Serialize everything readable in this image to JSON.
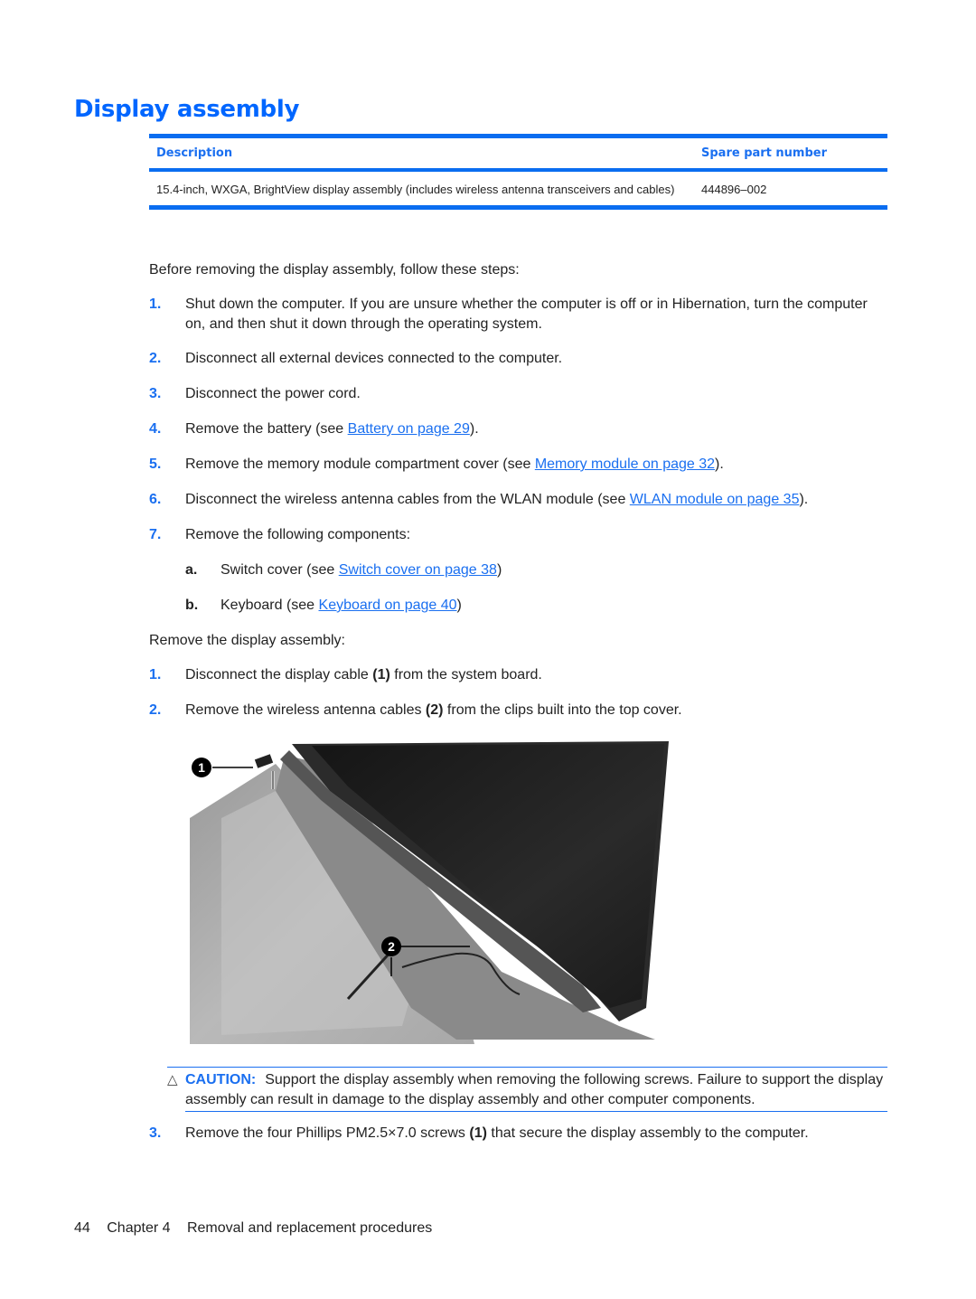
{
  "title": "Display assembly",
  "table": {
    "headers": {
      "description": "Description",
      "part_number": "Spare part number"
    },
    "rows": [
      {
        "description": "15.4-inch, WXGA, BrightView display assembly (includes wireless antenna transceivers and cables)",
        "part_number": "444896–002"
      }
    ]
  },
  "intro": "Before removing the display assembly, follow these steps:",
  "prep_steps": [
    {
      "num": "1.",
      "text": "Shut down the computer. If you are unsure whether the computer is off or in Hibernation, turn the computer on, and then shut it down through the operating system."
    },
    {
      "num": "2.",
      "text": "Disconnect all external devices connected to the computer."
    },
    {
      "num": "3.",
      "text": "Disconnect the power cord."
    },
    {
      "num": "4.",
      "text_before": "Remove the battery (see ",
      "link": "Battery on page 29",
      "text_after": ")."
    },
    {
      "num": "5.",
      "text_before": "Remove the memory module compartment cover (see ",
      "link": "Memory module on page 32",
      "text_after": ")."
    },
    {
      "num": "6.",
      "text_before": "Disconnect the wireless antenna cables from the WLAN module (see ",
      "link": "WLAN module on page 35",
      "text_after": ")."
    },
    {
      "num": "7.",
      "text": "Remove the following components:"
    }
  ],
  "sub_steps": [
    {
      "num": "a.",
      "text_before": "Switch cover (see ",
      "link": "Switch cover on page 38",
      "text_after": ")"
    },
    {
      "num": "b.",
      "text_before": "Keyboard (see ",
      "link": "Keyboard on page 40",
      "text_after": ")"
    }
  ],
  "remove_intro": "Remove the display assembly:",
  "remove_steps": [
    {
      "num": "1.",
      "text_before": "Disconnect the display cable ",
      "ref": "(1)",
      "text_after": " from the system board."
    },
    {
      "num": "2.",
      "text_before": "Remove the wireless antenna cables ",
      "ref": "(2)",
      "text_after": " from the clips built into the top cover."
    },
    {
      "num": "3.",
      "text_before": "Remove the four Phillips PM2.5×7.0 screws ",
      "ref": "(1)",
      "text_after": " that secure the display assembly to the computer."
    }
  ],
  "figure": {
    "callouts": [
      "1",
      "2"
    ]
  },
  "caution": {
    "icon": "caution-triangle-icon",
    "label": "CAUTION:",
    "text": "Support the display assembly when removing the following screws. Failure to support the display assembly can result in damage to the display assembly and other computer components."
  },
  "footer": {
    "page": "44",
    "chapter": "Chapter 4",
    "chapter_title": "Removal and replacement procedures"
  }
}
